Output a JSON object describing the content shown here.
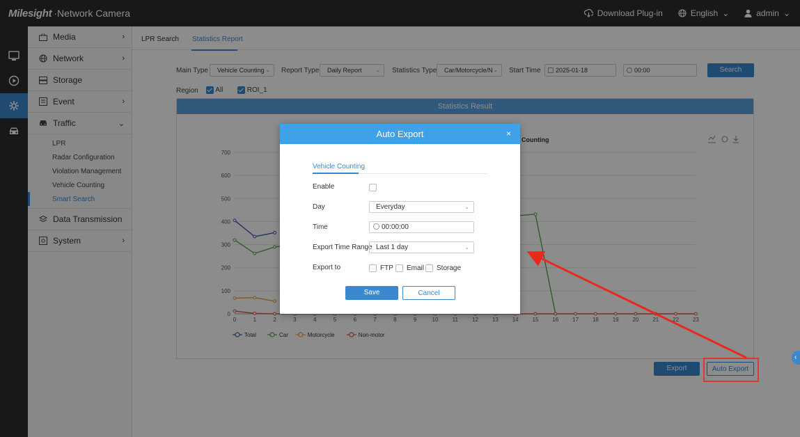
{
  "header": {
    "brand_logo": "Milesight",
    "brand_product": "Network Camera",
    "download_plugin": "Download Plug-in",
    "language": "English",
    "user": "admin"
  },
  "iconbar": [
    "monitor-icon",
    "playback-icon",
    "settings-icon",
    "vehicle-icon"
  ],
  "sidebar": {
    "items": [
      {
        "label": "Media",
        "icon": "media-icon",
        "arrow": "›"
      },
      {
        "label": "Network",
        "icon": "globe-icon",
        "arrow": "›"
      },
      {
        "label": "Storage",
        "icon": "storage-icon",
        "arrow": ""
      },
      {
        "label": "Event",
        "icon": "event-icon",
        "arrow": "›"
      },
      {
        "label": "Traffic",
        "icon": "car-icon",
        "arrow": "⌄"
      },
      {
        "label": "Data Transmission",
        "icon": "transmission-icon",
        "arrow": ""
      },
      {
        "label": "System",
        "icon": "system-icon",
        "arrow": "›"
      }
    ],
    "traffic_sub": [
      "LPR",
      "Radar Configuration",
      "Violation Management",
      "Vehicle Counting",
      "Smart Search"
    ]
  },
  "tabs": {
    "lpr_search": "LPR Search",
    "statistics_report": "Statistics Report"
  },
  "filters": {
    "main_type_label": "Main Type",
    "main_type_value": "Vehicle Counting",
    "report_type_label": "Report Type",
    "report_type_value": "Daily Report",
    "statistics_type_label": "Statistics Type",
    "statistics_type_value": "Car/Motorcycle/N",
    "start_time_label": "Start Time",
    "start_date": "2025-01-18",
    "start_time": "00:00",
    "search_button": "Search",
    "region_label": "Region",
    "region_all": "All",
    "region_roi": "ROI_1"
  },
  "result": {
    "header": "Statistics Result",
    "chart_title_visible": "Counting",
    "export_button": "Export",
    "auto_export_button": "Auto Export"
  },
  "chart_data": {
    "type": "line",
    "x": [
      0,
      1,
      2,
      3,
      4,
      5,
      6,
      7,
      8,
      9,
      10,
      11,
      12,
      13,
      14,
      15,
      16,
      17,
      18,
      19,
      20,
      21,
      22,
      23
    ],
    "ylim": [
      0,
      700
    ],
    "yticks": [
      0,
      100,
      200,
      300,
      400,
      500,
      600,
      700
    ],
    "legend": [
      "Total",
      "Car",
      "Motorcycle",
      "Non-motor"
    ],
    "series": [
      {
        "name": "Total",
        "color": "#3d5fb0",
        "points": [
          [
            0,
            405
          ],
          [
            1,
            335
          ],
          [
            2,
            352
          ]
        ]
      },
      {
        "name": "Car",
        "color": "#5aa14f",
        "points": [
          [
            0,
            320
          ],
          [
            1,
            262
          ],
          [
            2,
            290
          ],
          [
            14,
            425
          ],
          [
            15,
            432
          ],
          [
            16,
            0
          ]
        ]
      },
      {
        "name": "Motorcycle",
        "color": "#e8a33d",
        "points": [
          [
            0,
            68
          ],
          [
            1,
            70
          ],
          [
            2,
            55
          ]
        ]
      },
      {
        "name": "Non-motor",
        "color": "#d9534f",
        "points": [
          [
            0,
            12
          ],
          [
            1,
            2
          ],
          [
            2,
            0
          ],
          [
            3,
            0
          ],
          [
            4,
            0
          ],
          [
            5,
            0
          ],
          [
            6,
            0
          ],
          [
            7,
            0
          ],
          [
            8,
            0
          ],
          [
            9,
            0
          ],
          [
            10,
            0
          ],
          [
            11,
            0
          ],
          [
            12,
            0
          ],
          [
            13,
            0
          ],
          [
            14,
            0
          ],
          [
            15,
            0
          ],
          [
            16,
            0
          ],
          [
            17,
            0
          ],
          [
            18,
            0
          ],
          [
            19,
            0
          ],
          [
            20,
            0
          ],
          [
            21,
            0
          ],
          [
            22,
            0
          ],
          [
            23,
            0
          ]
        ]
      }
    ]
  },
  "modal": {
    "title": "Auto Export",
    "close": "×",
    "tab": "Vehicle Counting",
    "enable_label": "Enable",
    "day_label": "Day",
    "day_value": "Everyday",
    "time_label": "Time",
    "time_value": "00:00:00",
    "range_label": "Export Time Range",
    "range_value": "Last 1 day",
    "export_to_label": "Export to",
    "export_ftp": "FTP",
    "export_email": "Email",
    "export_storage": "Storage",
    "save": "Save",
    "cancel": "Cancel"
  },
  "colors": {
    "accent": "#3a89d0",
    "annotation": "#e8291d"
  }
}
